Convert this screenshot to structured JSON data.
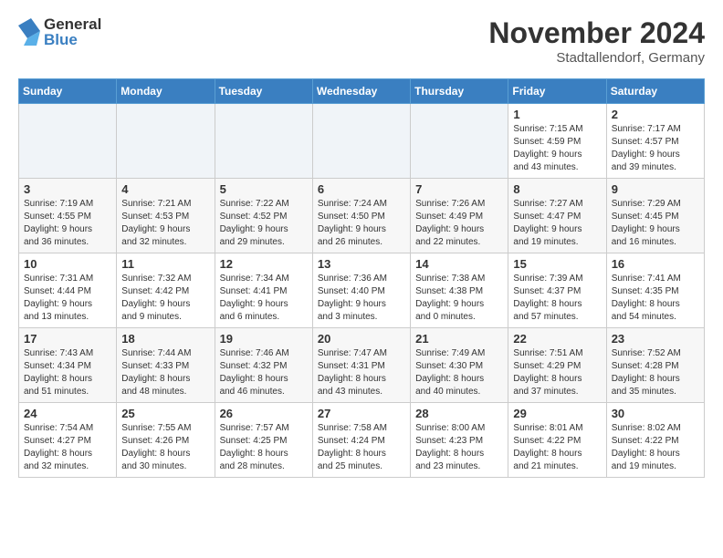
{
  "logo": {
    "general": "General",
    "blue": "Blue"
  },
  "title": "November 2024",
  "subtitle": "Stadtallendorf, Germany",
  "weekdays": [
    "Sunday",
    "Monday",
    "Tuesday",
    "Wednesday",
    "Thursday",
    "Friday",
    "Saturday"
  ],
  "weeks": [
    [
      {
        "day": "",
        "info": ""
      },
      {
        "day": "",
        "info": ""
      },
      {
        "day": "",
        "info": ""
      },
      {
        "day": "",
        "info": ""
      },
      {
        "day": "",
        "info": ""
      },
      {
        "day": "1",
        "info": "Sunrise: 7:15 AM\nSunset: 4:59 PM\nDaylight: 9 hours\nand 43 minutes."
      },
      {
        "day": "2",
        "info": "Sunrise: 7:17 AM\nSunset: 4:57 PM\nDaylight: 9 hours\nand 39 minutes."
      }
    ],
    [
      {
        "day": "3",
        "info": "Sunrise: 7:19 AM\nSunset: 4:55 PM\nDaylight: 9 hours\nand 36 minutes."
      },
      {
        "day": "4",
        "info": "Sunrise: 7:21 AM\nSunset: 4:53 PM\nDaylight: 9 hours\nand 32 minutes."
      },
      {
        "day": "5",
        "info": "Sunrise: 7:22 AM\nSunset: 4:52 PM\nDaylight: 9 hours\nand 29 minutes."
      },
      {
        "day": "6",
        "info": "Sunrise: 7:24 AM\nSunset: 4:50 PM\nDaylight: 9 hours\nand 26 minutes."
      },
      {
        "day": "7",
        "info": "Sunrise: 7:26 AM\nSunset: 4:49 PM\nDaylight: 9 hours\nand 22 minutes."
      },
      {
        "day": "8",
        "info": "Sunrise: 7:27 AM\nSunset: 4:47 PM\nDaylight: 9 hours\nand 19 minutes."
      },
      {
        "day": "9",
        "info": "Sunrise: 7:29 AM\nSunset: 4:45 PM\nDaylight: 9 hours\nand 16 minutes."
      }
    ],
    [
      {
        "day": "10",
        "info": "Sunrise: 7:31 AM\nSunset: 4:44 PM\nDaylight: 9 hours\nand 13 minutes."
      },
      {
        "day": "11",
        "info": "Sunrise: 7:32 AM\nSunset: 4:42 PM\nDaylight: 9 hours\nand 9 minutes."
      },
      {
        "day": "12",
        "info": "Sunrise: 7:34 AM\nSunset: 4:41 PM\nDaylight: 9 hours\nand 6 minutes."
      },
      {
        "day": "13",
        "info": "Sunrise: 7:36 AM\nSunset: 4:40 PM\nDaylight: 9 hours\nand 3 minutes."
      },
      {
        "day": "14",
        "info": "Sunrise: 7:38 AM\nSunset: 4:38 PM\nDaylight: 9 hours\nand 0 minutes."
      },
      {
        "day": "15",
        "info": "Sunrise: 7:39 AM\nSunset: 4:37 PM\nDaylight: 8 hours\nand 57 minutes."
      },
      {
        "day": "16",
        "info": "Sunrise: 7:41 AM\nSunset: 4:35 PM\nDaylight: 8 hours\nand 54 minutes."
      }
    ],
    [
      {
        "day": "17",
        "info": "Sunrise: 7:43 AM\nSunset: 4:34 PM\nDaylight: 8 hours\nand 51 minutes."
      },
      {
        "day": "18",
        "info": "Sunrise: 7:44 AM\nSunset: 4:33 PM\nDaylight: 8 hours\nand 48 minutes."
      },
      {
        "day": "19",
        "info": "Sunrise: 7:46 AM\nSunset: 4:32 PM\nDaylight: 8 hours\nand 46 minutes."
      },
      {
        "day": "20",
        "info": "Sunrise: 7:47 AM\nSunset: 4:31 PM\nDaylight: 8 hours\nand 43 minutes."
      },
      {
        "day": "21",
        "info": "Sunrise: 7:49 AM\nSunset: 4:30 PM\nDaylight: 8 hours\nand 40 minutes."
      },
      {
        "day": "22",
        "info": "Sunrise: 7:51 AM\nSunset: 4:29 PM\nDaylight: 8 hours\nand 37 minutes."
      },
      {
        "day": "23",
        "info": "Sunrise: 7:52 AM\nSunset: 4:28 PM\nDaylight: 8 hours\nand 35 minutes."
      }
    ],
    [
      {
        "day": "24",
        "info": "Sunrise: 7:54 AM\nSunset: 4:27 PM\nDaylight: 8 hours\nand 32 minutes."
      },
      {
        "day": "25",
        "info": "Sunrise: 7:55 AM\nSunset: 4:26 PM\nDaylight: 8 hours\nand 30 minutes."
      },
      {
        "day": "26",
        "info": "Sunrise: 7:57 AM\nSunset: 4:25 PM\nDaylight: 8 hours\nand 28 minutes."
      },
      {
        "day": "27",
        "info": "Sunrise: 7:58 AM\nSunset: 4:24 PM\nDaylight: 8 hours\nand 25 minutes."
      },
      {
        "day": "28",
        "info": "Sunrise: 8:00 AM\nSunset: 4:23 PM\nDaylight: 8 hours\nand 23 minutes."
      },
      {
        "day": "29",
        "info": "Sunrise: 8:01 AM\nSunset: 4:22 PM\nDaylight: 8 hours\nand 21 minutes."
      },
      {
        "day": "30",
        "info": "Sunrise: 8:02 AM\nSunset: 4:22 PM\nDaylight: 8 hours\nand 19 minutes."
      }
    ]
  ]
}
